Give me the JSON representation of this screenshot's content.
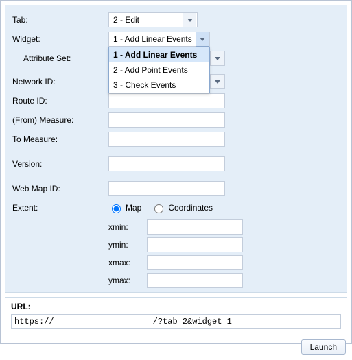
{
  "labels": {
    "tab": "Tab:",
    "widget": "Widget:",
    "attribute_set": "Attribute Set:",
    "network_id": "Network ID:",
    "route_id": "Route ID:",
    "from_measure": "(From) Measure:",
    "to_measure": "To Measure:",
    "version": "Version:",
    "web_map_id": "Web Map ID:",
    "extent": "Extent:",
    "xmin": "xmin:",
    "ymin": "ymin:",
    "xmax": "xmax:",
    "ymax": "ymax:"
  },
  "values": {
    "tab": "2 - Edit",
    "widget": "1 - Add Linear Events",
    "attribute_set": "",
    "network_id": "",
    "route_id": "",
    "from_measure": "",
    "to_measure": "",
    "version": "",
    "web_map_id": "",
    "xmin": "",
    "ymin": "",
    "xmax": "",
    "ymax": ""
  },
  "widget_options": [
    "1 - Add Linear Events",
    "2 - Add Point Events",
    "3 - Check Events"
  ],
  "extent_radio": {
    "map": "Map",
    "coordinates": "Coordinates",
    "selected": "map"
  },
  "url": {
    "label": "URL:",
    "value": "https://                    /?tab=2&widget=1"
  },
  "buttons": {
    "launch": "Launch"
  }
}
